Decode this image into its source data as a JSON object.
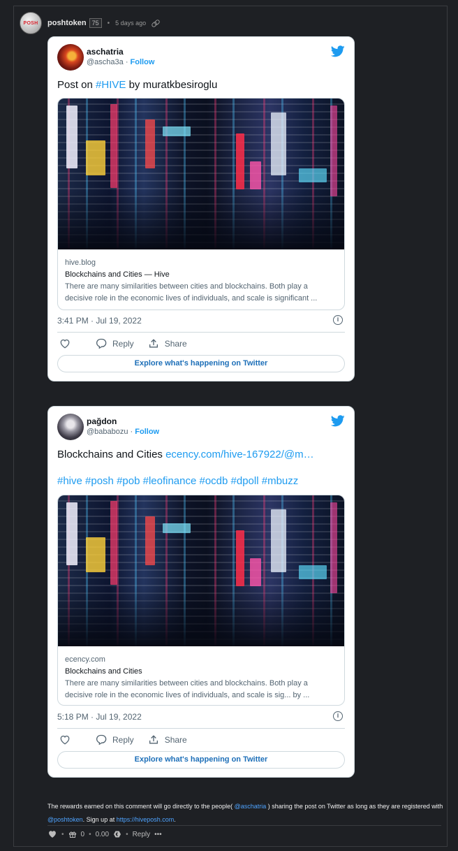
{
  "comment": {
    "author": "poshtoken",
    "avatar_text": "POSH",
    "reputation": "75",
    "separator": "•",
    "time_ago": "5 days ago"
  },
  "tweets": [
    {
      "name": "aschatria",
      "handle": "@ascha3a",
      "handle_sep": " · ",
      "follow": "Follow",
      "text_prefix": "Post on ",
      "text_link": "#HIVE",
      "text_suffix": " by muratkbesiroglu",
      "card": {
        "domain": "hive.blog",
        "title": "Blockchains and Cities — Hive",
        "desc_line1": "There are many similarities between cities and blockchains. Both play a",
        "desc_line2": "decisive role in the economic lives of individuals, and scale is significant ..."
      },
      "time": "3:41 PM · Jul 19, 2022",
      "reply_label": "Reply",
      "share_label": "Share",
      "explore_label": "Explore what's happening on Twitter"
    },
    {
      "name": "pağdon",
      "handle": "@bababozu",
      "handle_sep": " · ",
      "follow": "Follow",
      "text_prefix": "Blockchains and Cities ",
      "text_link": "ecency.com/hive-167922/@m…",
      "hashtags": "#hive #posh #pob #leofinance #ocdb #dpoll #mbuzz",
      "card": {
        "domain": "ecency.com",
        "title": "Blockchains and Cities",
        "desc_line1": "There are many similarities between cities and blockchains. Both play a",
        "desc_line2": "decisive role in the economic lives of individuals, and scale is sig... by ..."
      },
      "time": "5:18 PM · Jul 19, 2022",
      "reply_label": "Reply",
      "share_label": "Share",
      "explore_label": "Explore what's happening on Twitter"
    }
  ],
  "footer": {
    "text_before": "The rewards earned on this comment will go directly to the people( ",
    "mention_aschatria": "@aschatria",
    "text_middle": " ) sharing the post on Twitter as long as they are registered with ",
    "mention_poshtoken": "@poshtoken",
    "text_signup": ". Sign up at ",
    "signup_link": "https://hiveposh.com",
    "text_end": ".",
    "bullet": "•",
    "votes": "0",
    "payout": "0.00",
    "reply_label": "Reply",
    "more_label": "•••"
  },
  "colors": {
    "page_bg": "#1e2024",
    "twitter_blue": "#1d9bf0",
    "link_blue": "#4ea3ff"
  },
  "icons": [
    "link-icon",
    "twitter-bird-icon",
    "heart-icon",
    "reply-icon",
    "share-icon",
    "info-icon",
    "gift-icon",
    "hive-icon",
    "more-icon"
  ]
}
